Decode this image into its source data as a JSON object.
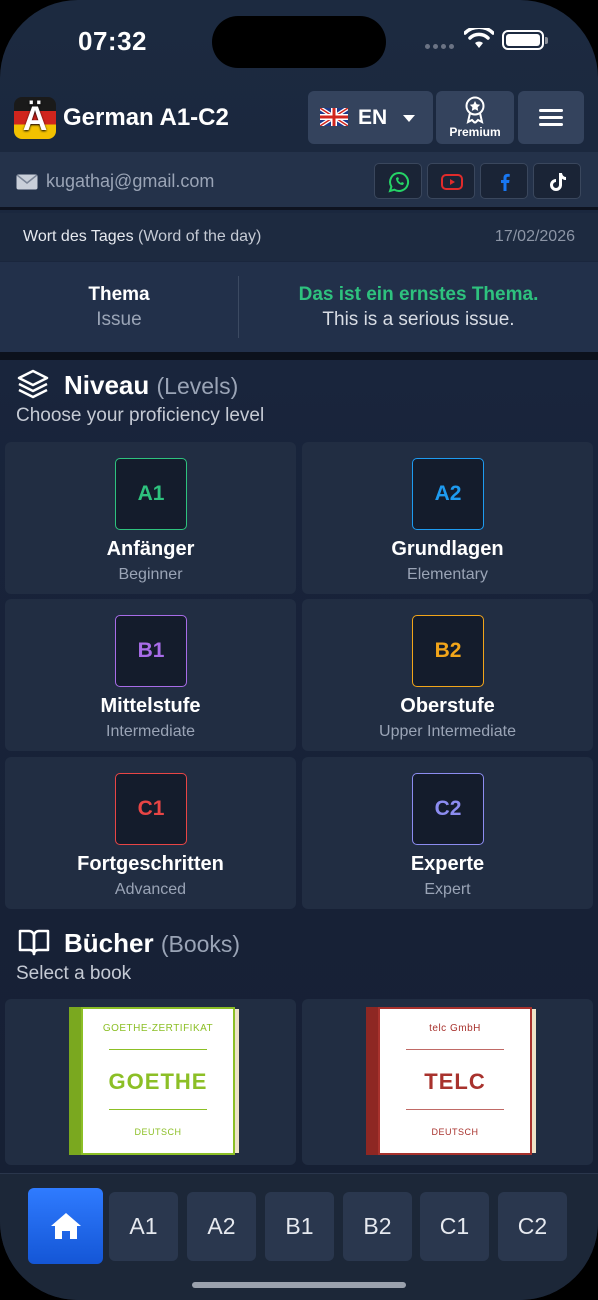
{
  "status": {
    "time": "07:32"
  },
  "header": {
    "title": "German A1-C2",
    "logo_letter": "Ä",
    "language": "EN",
    "premium_label": "Premium"
  },
  "account": {
    "email": "kugathaj@gmail.com"
  },
  "word_of_day": {
    "label": "Wort des Tages",
    "label_en": "(Word of the day)",
    "date": "17/02/2026",
    "word": "Thema",
    "word_en": "Issue",
    "sentence": "Das ist ein ernstes Thema.",
    "sentence_en": "This is a serious issue."
  },
  "levels": {
    "title": "Niveau",
    "title_en": "(Levels)",
    "subtitle": "Choose your proficiency level",
    "items": [
      {
        "code": "A1",
        "name": "Anfänger",
        "en": "Beginner",
        "color": "#2ec27e"
      },
      {
        "code": "A2",
        "name": "Grundlagen",
        "en": "Elementary",
        "color": "#1e9bf0"
      },
      {
        "code": "B1",
        "name": "Mittelstufe",
        "en": "Intermediate",
        "color": "#a86ce8"
      },
      {
        "code": "B2",
        "name": "Oberstufe",
        "en": "Upper Intermediate",
        "color": "#f2a51a"
      },
      {
        "code": "C1",
        "name": "Fortgeschritten",
        "en": "Advanced",
        "color": "#e84545"
      },
      {
        "code": "C2",
        "name": "Experte",
        "en": "Expert",
        "color": "#8c8cf0"
      }
    ]
  },
  "books": {
    "title": "Bücher",
    "title_en": "(Books)",
    "subtitle": "Select a book",
    "items": [
      {
        "top": "GOETHE-ZERTIFIKAT",
        "name": "GOETHE",
        "bottom": "DEUTSCH",
        "color": "#8cbf26"
      },
      {
        "top": "telc GmbH",
        "name": "TELC",
        "bottom": "DEUTSCH",
        "color": "#a8322d"
      }
    ]
  },
  "tabs": [
    "A1",
    "A2",
    "B1",
    "B2",
    "C1",
    "C2"
  ],
  "icons": [
    "wifi-icon",
    "battery-icon",
    "flag-uk-icon",
    "premium-badge-icon",
    "menu-icon",
    "mail-icon",
    "whatsapp-icon",
    "youtube-icon",
    "facebook-icon",
    "tiktok-icon",
    "layers-icon",
    "book-icon",
    "home-icon"
  ]
}
